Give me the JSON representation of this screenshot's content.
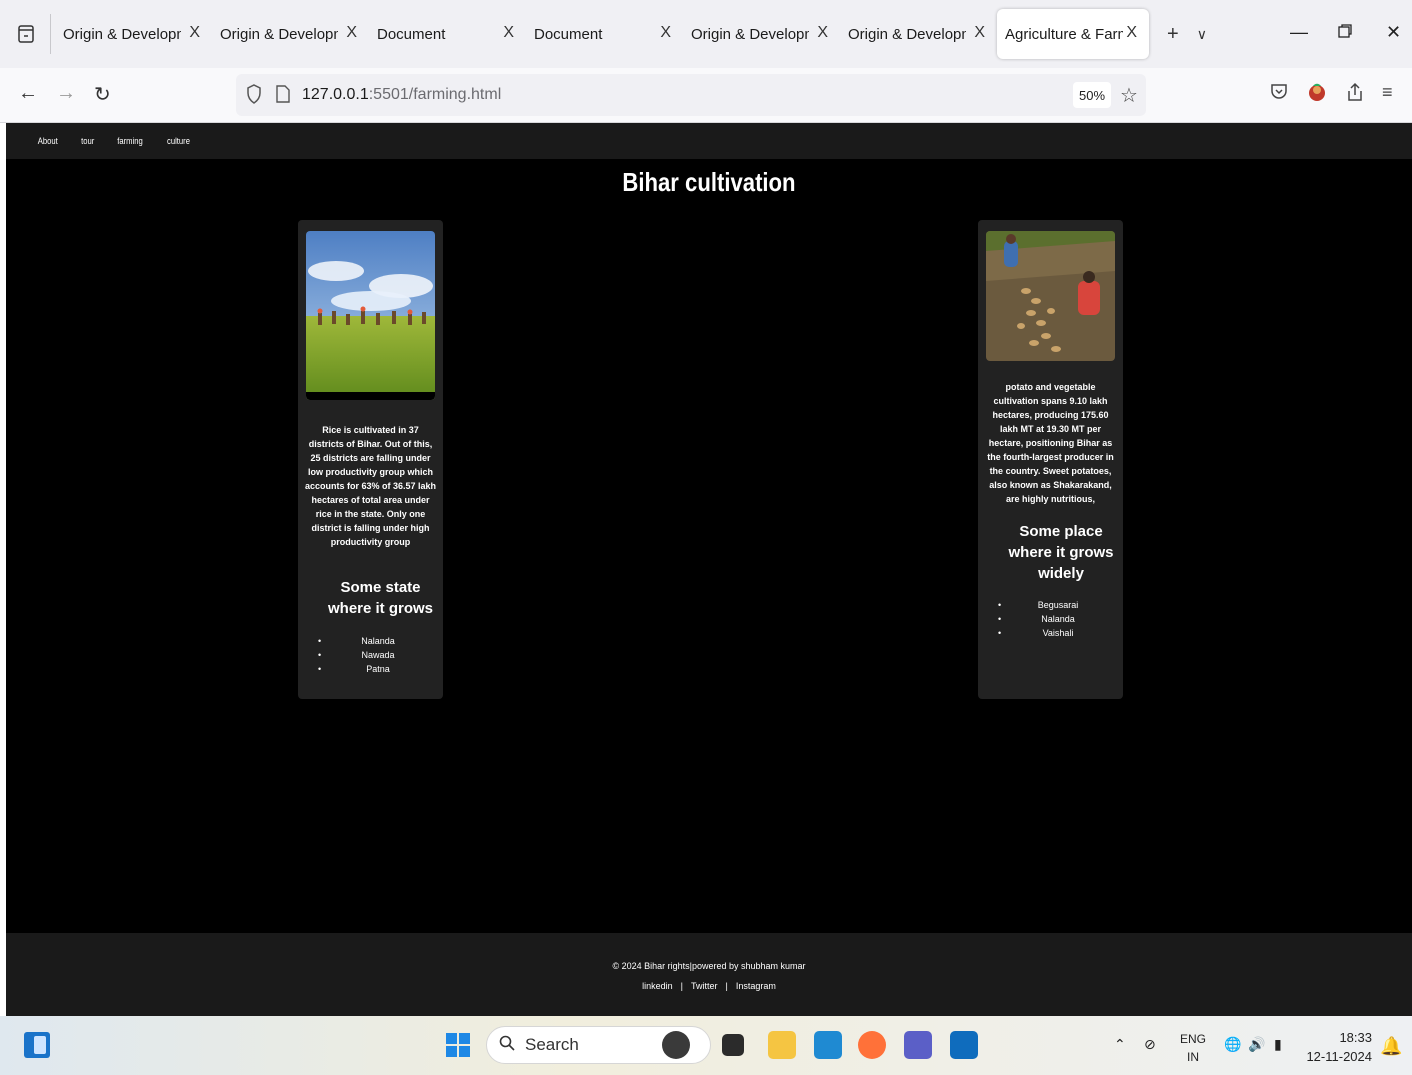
{
  "browser": {
    "tabs": [
      {
        "label": "Origin & Developmen",
        "active": false
      },
      {
        "label": "Origin & Developmen",
        "active": false
      },
      {
        "label": "Document",
        "active": false
      },
      {
        "label": "Document",
        "active": false
      },
      {
        "label": "Origin & Developmen",
        "active": false
      },
      {
        "label": "Origin & Developmen",
        "active": false
      },
      {
        "label": "Agriculture & Farmin",
        "active": true
      }
    ],
    "tab_close_glyph": "X",
    "url_host": "127.0.0.1",
    "url_rest": ":5501/farming.html",
    "zoom": "50%"
  },
  "page": {
    "nav": [
      "About",
      "tour",
      "farming",
      "culture"
    ],
    "title": "Bihar cultivation",
    "cards": [
      {
        "image_alt": "rice field with workers",
        "description": "Rice is cultivated in 37 districts of Bihar. Out of this, 25 districts are falling under low productivity group which accounts for 63% of 36.57 lakh hectares of total area under rice in the state. Only one district is falling under high productivity group",
        "heading": "Some state where it grows",
        "items": [
          "Nalanda",
          "Nawada",
          "Patna"
        ]
      },
      {
        "image_alt": "potato harvest field",
        "description": "potato and vegetable cultivation spans 9.10 lakh hectares, producing 175.60 lakh MT at 19.30 MT per hectare, positioning Bihar as the fourth-largest producer in the country. Sweet potatoes, also known as Shakarakand, are highly nutritious,",
        "heading": "Some place where it grows widely",
        "items": [
          "Begusarai",
          "Nalanda",
          "Vaishali"
        ]
      }
    ],
    "footer": {
      "copyright": "© 2024 Bihar rights|powered by shubham kumar",
      "links": [
        "linkedin",
        "Twitter",
        "Instagram"
      ],
      "separator": "|"
    }
  },
  "taskbar": {
    "search_placeholder": "Search",
    "lang_top": "ENG",
    "lang_bottom": "IN",
    "time": "18:33",
    "date": "12-11-2024"
  }
}
